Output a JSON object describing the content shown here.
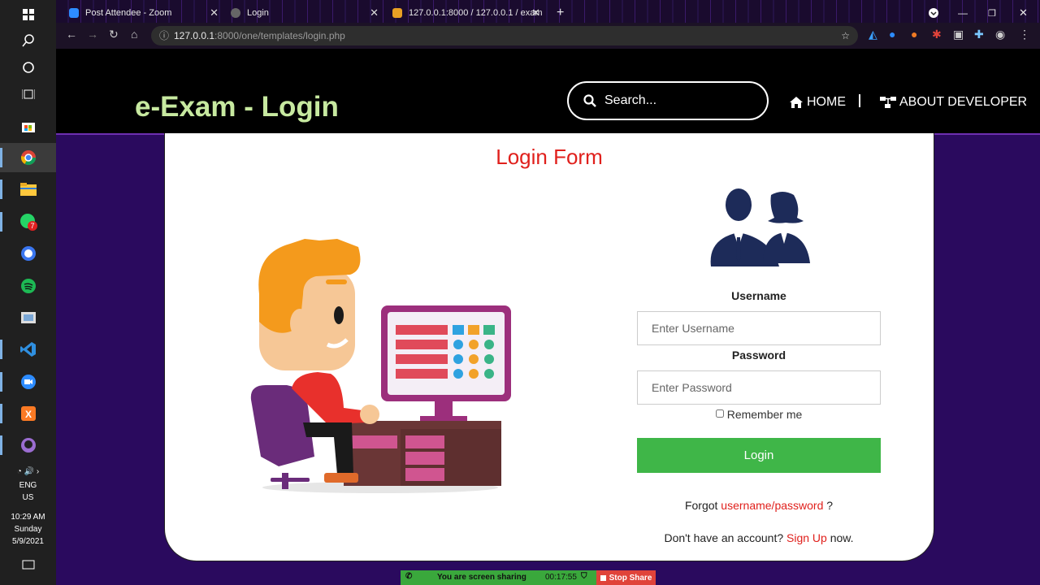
{
  "taskbar": {
    "tray": {
      "lang1": "ENG",
      "lang2": "US",
      "time": "10:29 AM",
      "day": "Sunday",
      "date": "5/9/2021"
    },
    "badge_count": "7"
  },
  "browser": {
    "tabs": [
      {
        "title": "Post Attendee - Zoom"
      },
      {
        "title": "Login"
      },
      {
        "title": "127.0.0.1:8000 / 127.0.0.1 / exam"
      }
    ],
    "url_host": "127.0.0.1",
    "url_rest": ":8000/one/templates/login.php"
  },
  "site": {
    "brand": "e-Exam - Login",
    "search_placeholder": "Search...",
    "nav_home": "HOME",
    "nav_about": "ABOUT DEVELOPER"
  },
  "form": {
    "title": "Login Form",
    "username_label": "Username",
    "username_placeholder": "Enter Username",
    "password_label": "Password",
    "password_placeholder": "Enter Password",
    "remember": "Remember me",
    "login_button": "Login",
    "forgot_prefix": "Forgot",
    "forgot_link": "username/password",
    "forgot_suffix": "?",
    "signup_prefix": "Don't have an account?",
    "signup_link": "Sign Up",
    "signup_suffix": "now."
  },
  "zoom": {
    "sharing_text": "You are screen sharing",
    "timer": "00:17:55",
    "stop_label": "Stop Share"
  }
}
